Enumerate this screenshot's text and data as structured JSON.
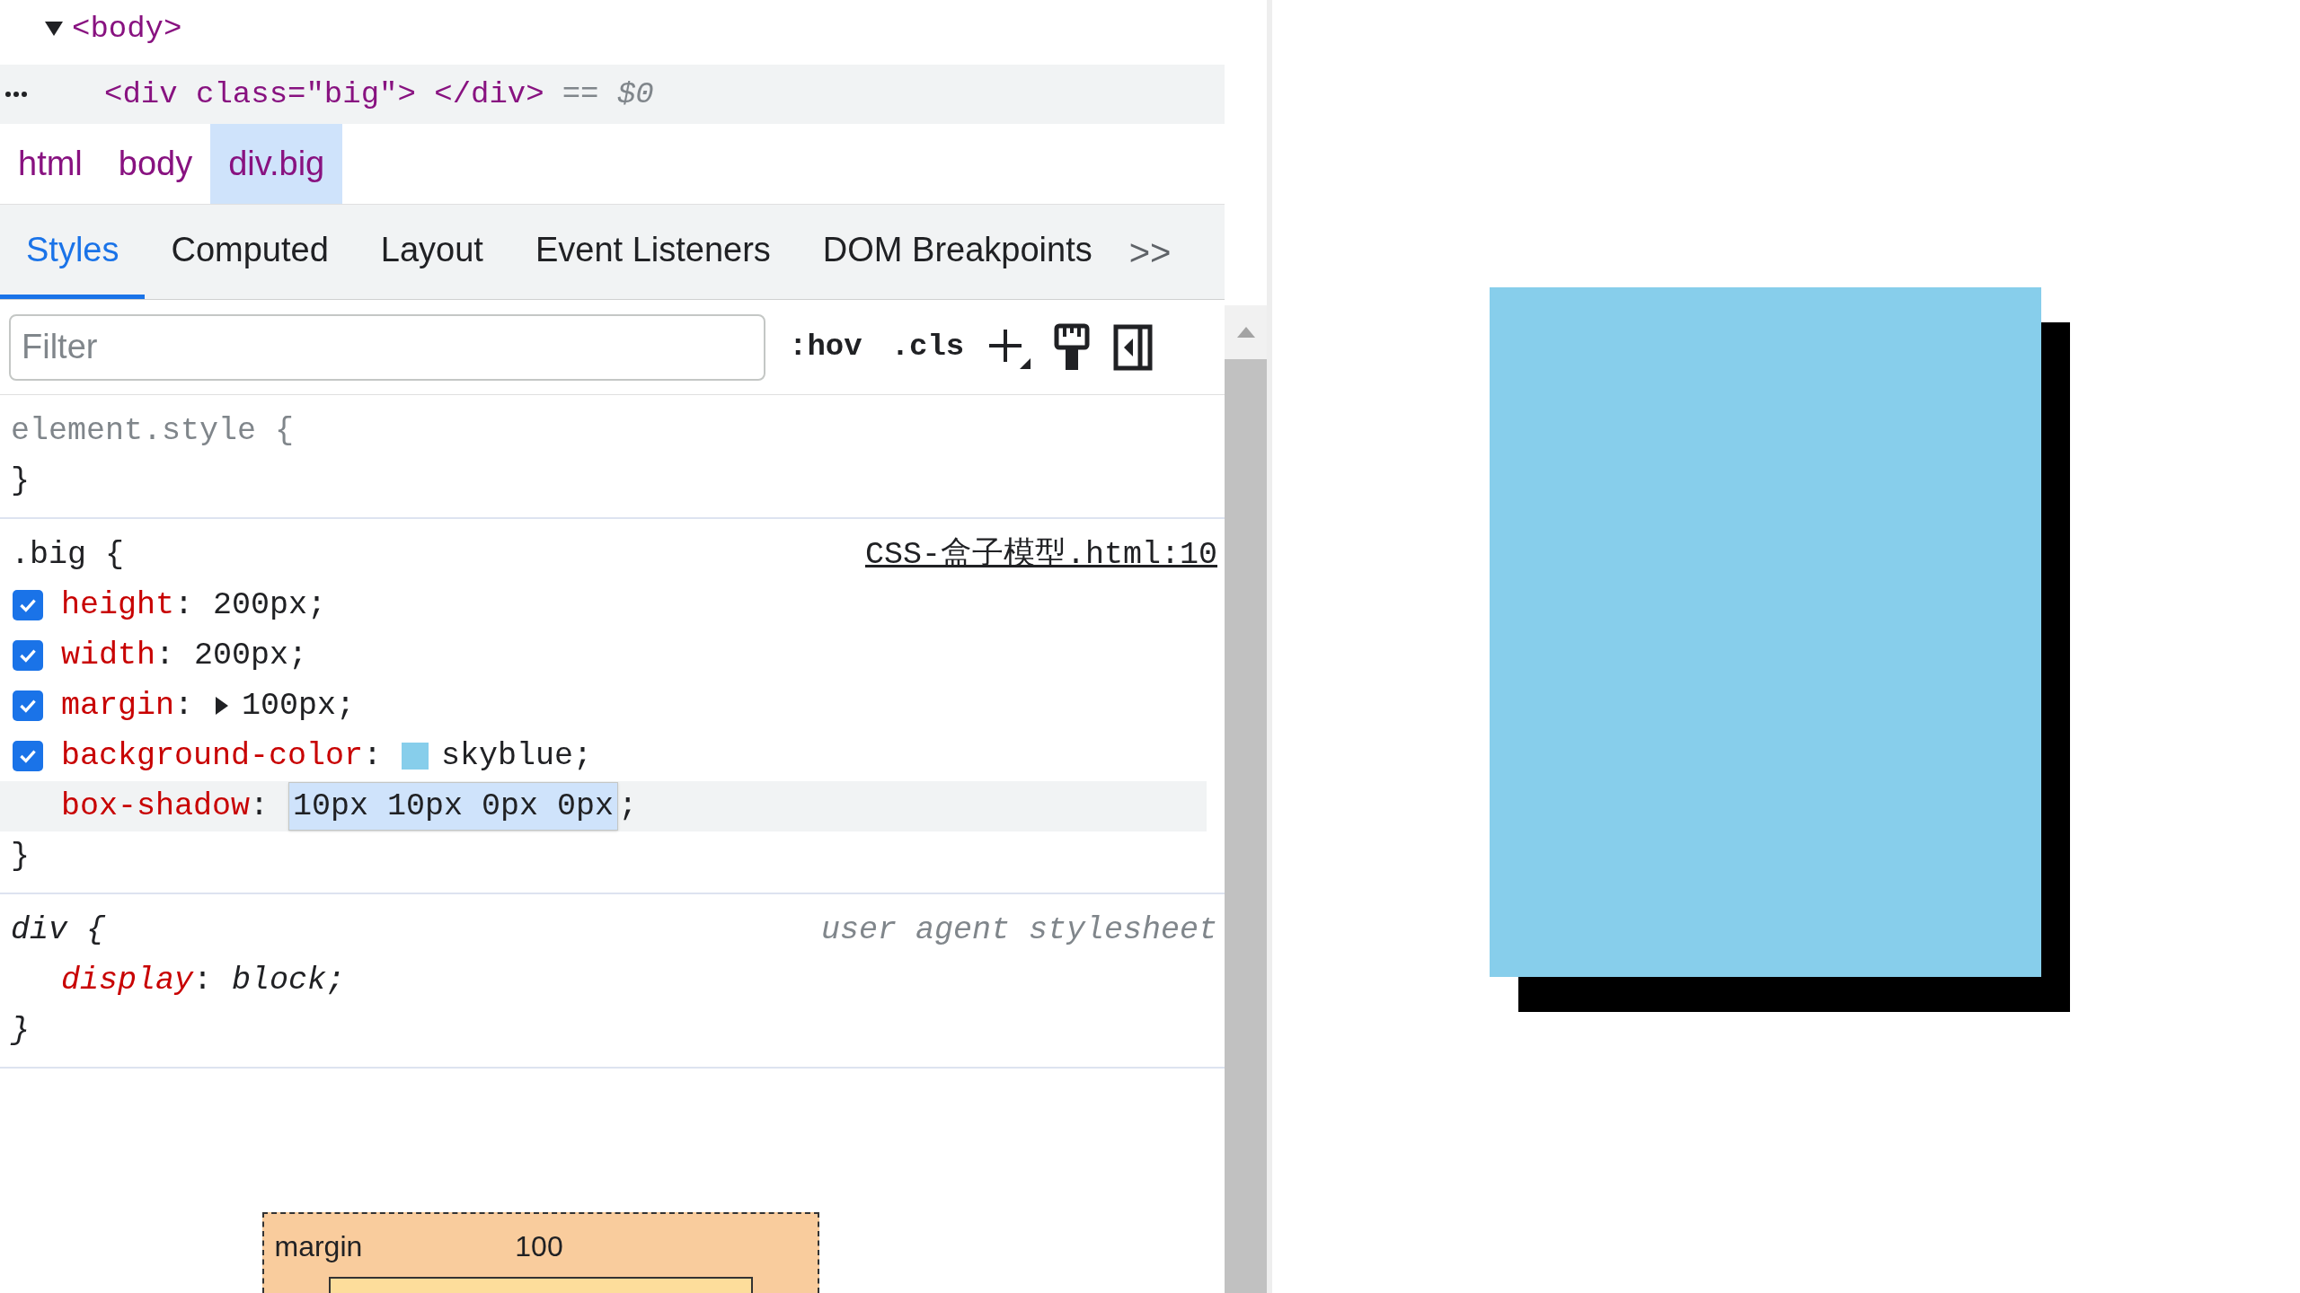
{
  "elements": [
    {
      "kind": "open",
      "text": "<body>",
      "expanded": true,
      "selected": false
    },
    {
      "kind": "node",
      "text": "<div class=\"big\"> </div>",
      "suffix": "== $0",
      "selected": true
    }
  ],
  "breadcrumbs": [
    {
      "label": "html",
      "selected": false
    },
    {
      "label": "body",
      "selected": false
    },
    {
      "label": "div.big",
      "selected": true
    }
  ],
  "tabs": [
    {
      "label": "Styles",
      "selected": true
    },
    {
      "label": "Computed",
      "selected": false
    },
    {
      "label": "Layout",
      "selected": false
    },
    {
      "label": "Event Listeners",
      "selected": false
    },
    {
      "label": "DOM Breakpoints",
      "selected": false
    }
  ],
  "more_tabs": ">>",
  "filter": {
    "placeholder": "Filter"
  },
  "toolbar": [
    ":hov",
    ".cls"
  ],
  "rules": [
    {
      "kind": "inline",
      "selector": "element.style {",
      "close": "}"
    },
    {
      "kind": "author",
      "selector": ".big {",
      "source": "CSS-盒子模型.html:10",
      "close": "}",
      "properties": [
        {
          "kind": "normal",
          "name": "height",
          "sep": ":",
          "value": "200px;",
          "checked": true
        },
        {
          "kind": "normal",
          "name": "width",
          "sep": ":",
          "value": "200px;",
          "checked": true
        },
        {
          "kind": "shorthand",
          "name": "margin",
          "sep": ":",
          "value": "100px;",
          "checked": true,
          "expanded": false
        },
        {
          "kind": "color",
          "name": "background-color",
          "sep": ":",
          "value": "skyblue;",
          "checked": true,
          "color": "#87ceeb"
        },
        {
          "kind": "editing",
          "name": "box-shadow",
          "sep": ":",
          "value": "10px 10px 0px 0px",
          "tail": ";"
        }
      ]
    },
    {
      "kind": "user-agent",
      "selector": "div {",
      "source": "user agent stylesheet",
      "close": "}",
      "properties": [
        {
          "kind": "normal",
          "name": "display",
          "sep": ":",
          "value": "block;"
        }
      ]
    }
  ],
  "box_model": {
    "label": "margin",
    "value": "100"
  },
  "preview": {
    "color": "#87ceeb"
  }
}
